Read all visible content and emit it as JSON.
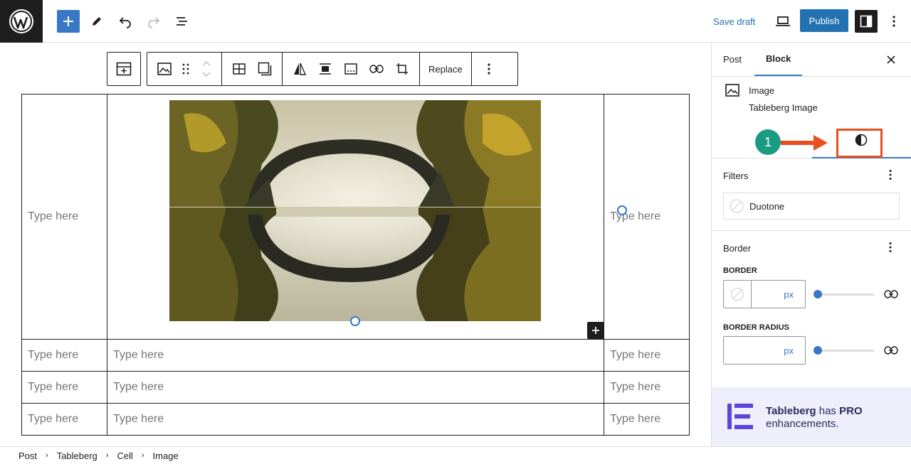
{
  "topbar": {
    "save_draft": "Save draft",
    "publish": "Publish"
  },
  "block_toolbar": {
    "replace": "Replace"
  },
  "table": {
    "placeholder": "Type here",
    "rows": [
      [
        "Type here",
        "",
        "Type here"
      ],
      [
        "Type here",
        "Type here",
        "Type here"
      ],
      [
        "Type here",
        "Type here",
        "Type here"
      ],
      [
        "Type here",
        "Type here",
        "Type here"
      ]
    ]
  },
  "sidebar": {
    "tabs": [
      "Post",
      "Block"
    ],
    "active_tab": "Block",
    "block_title": "Image",
    "block_subtitle": "Tableberg Image",
    "filters_title": "Filters",
    "duotone_label": "Duotone",
    "border_title": "Border",
    "border_label": "BORDER",
    "border_unit": "px",
    "radius_label": "BORDER RADIUS",
    "radius_unit": "px",
    "border_slider_value": 0,
    "radius_slider_value": 0
  },
  "promo": {
    "brand": "Tableberg",
    "has": "has",
    "pro": "PRO",
    "enhancements": "enhancements."
  },
  "annotation": {
    "step_number": "1",
    "color_badge": "#1a9c82",
    "color_arrow": "#e8501f"
  },
  "breadcrumbs": [
    "Post",
    "Tableberg",
    "Cell",
    "Image"
  ],
  "colors": {
    "accent": "#2271b1",
    "dark": "#1e1e1e"
  }
}
